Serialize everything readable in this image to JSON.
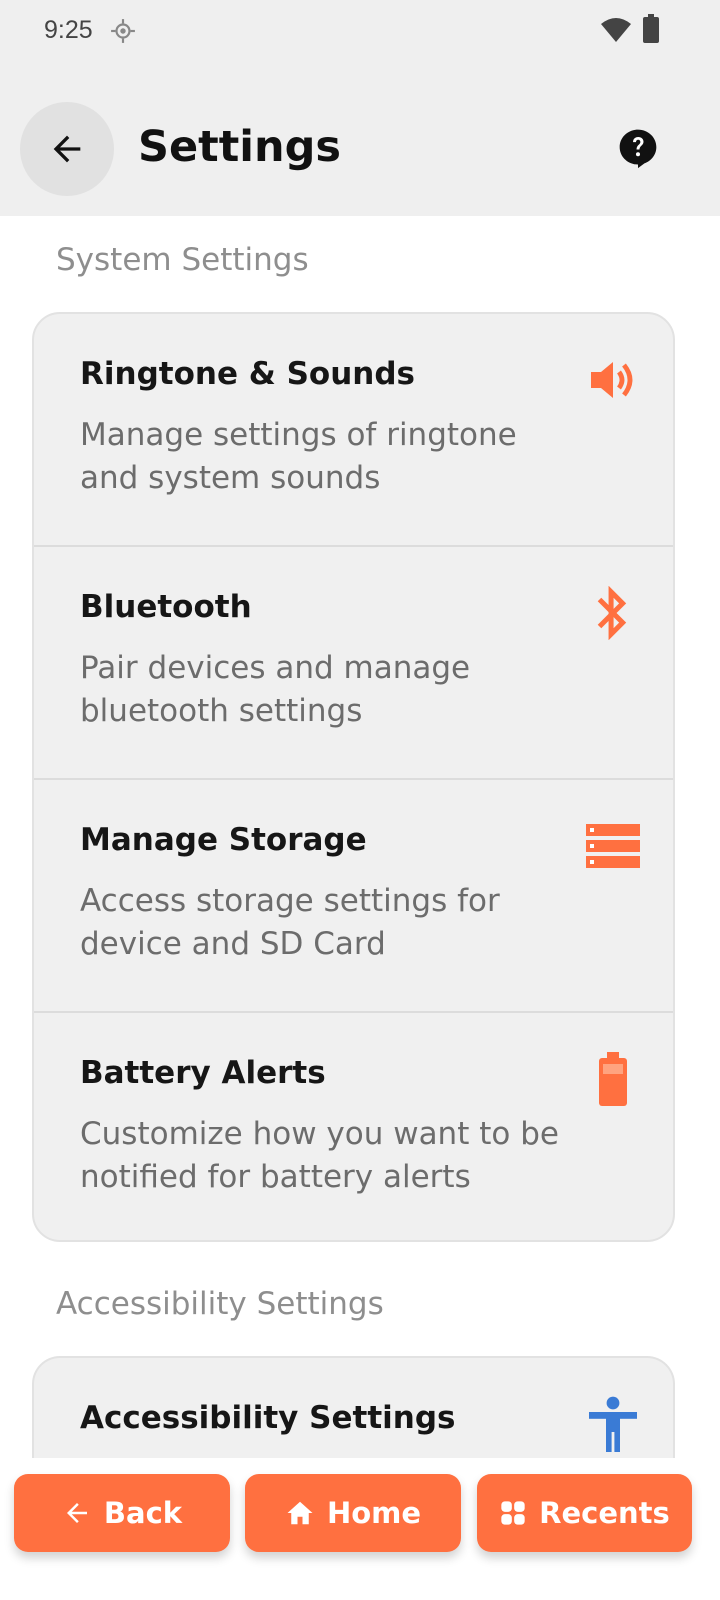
{
  "status_bar": {
    "time": "9:25"
  },
  "app_bar": {
    "title": "Settings"
  },
  "sections": {
    "system": {
      "title": "System Settings"
    },
    "accessibility": {
      "title": "Accessibility Settings"
    }
  },
  "system_items": [
    {
      "title": "Ringtone & Sounds",
      "description": "Manage settings of ringtone and system sounds",
      "icon": "speaker-icon"
    },
    {
      "title": "Bluetooth",
      "description": "Pair devices and manage bluetooth settings",
      "icon": "bluetooth-icon"
    },
    {
      "title": "Manage Storage",
      "description": "Access storage settings for device and SD Card",
      "icon": "storage-icon"
    },
    {
      "title": "Battery Alerts",
      "description": "Customize how you want to be notified for battery alerts",
      "icon": "battery-icon"
    }
  ],
  "accessibility_items": [
    {
      "title": "Accessibility Settings",
      "icon": "accessibility-icon"
    }
  ],
  "bottom_nav": {
    "back_label": "Back",
    "home_label": "Home",
    "recents_label": "Recents"
  },
  "colors": {
    "accent": "#ff7040",
    "accessibility_icon": "#3a7bd5",
    "header_bg": "#efefef",
    "card_bg": "#f0f0f0"
  }
}
